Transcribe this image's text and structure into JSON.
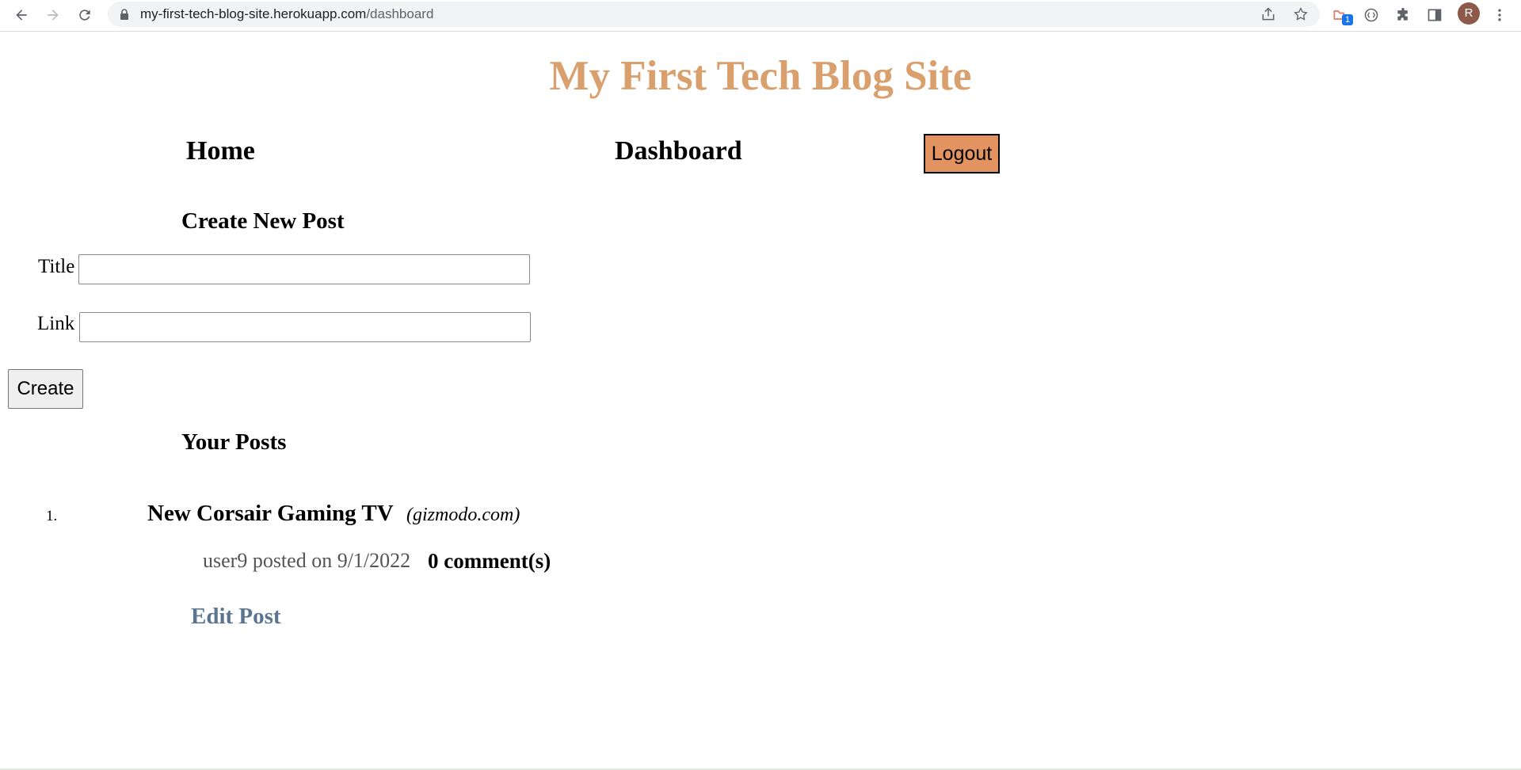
{
  "browser": {
    "url_host": "my-first-tech-blog-site.herokuapp.com",
    "url_path": "/dashboard",
    "extension_badge": "1",
    "profile_initial": "R"
  },
  "site": {
    "title": "My First Tech Blog Site",
    "title_color": "#d9a06e"
  },
  "nav": {
    "home": "Home",
    "dashboard": "Dashboard",
    "logout": "Logout",
    "logout_color": "#e3935f"
  },
  "create_post": {
    "heading": "Create New Post",
    "title_label": "Title",
    "title_value": "",
    "link_label": "Link",
    "link_value": "",
    "create_button": "Create"
  },
  "your_posts": {
    "heading": "Your Posts",
    "posts": [
      {
        "number": "1.",
        "title": "New Corsair Gaming TV",
        "domain": "(gizmodo.com)",
        "meta": "user9 posted on 9/1/2022",
        "comments": "0 comment(s)",
        "edit_label": "Edit Post"
      }
    ]
  }
}
